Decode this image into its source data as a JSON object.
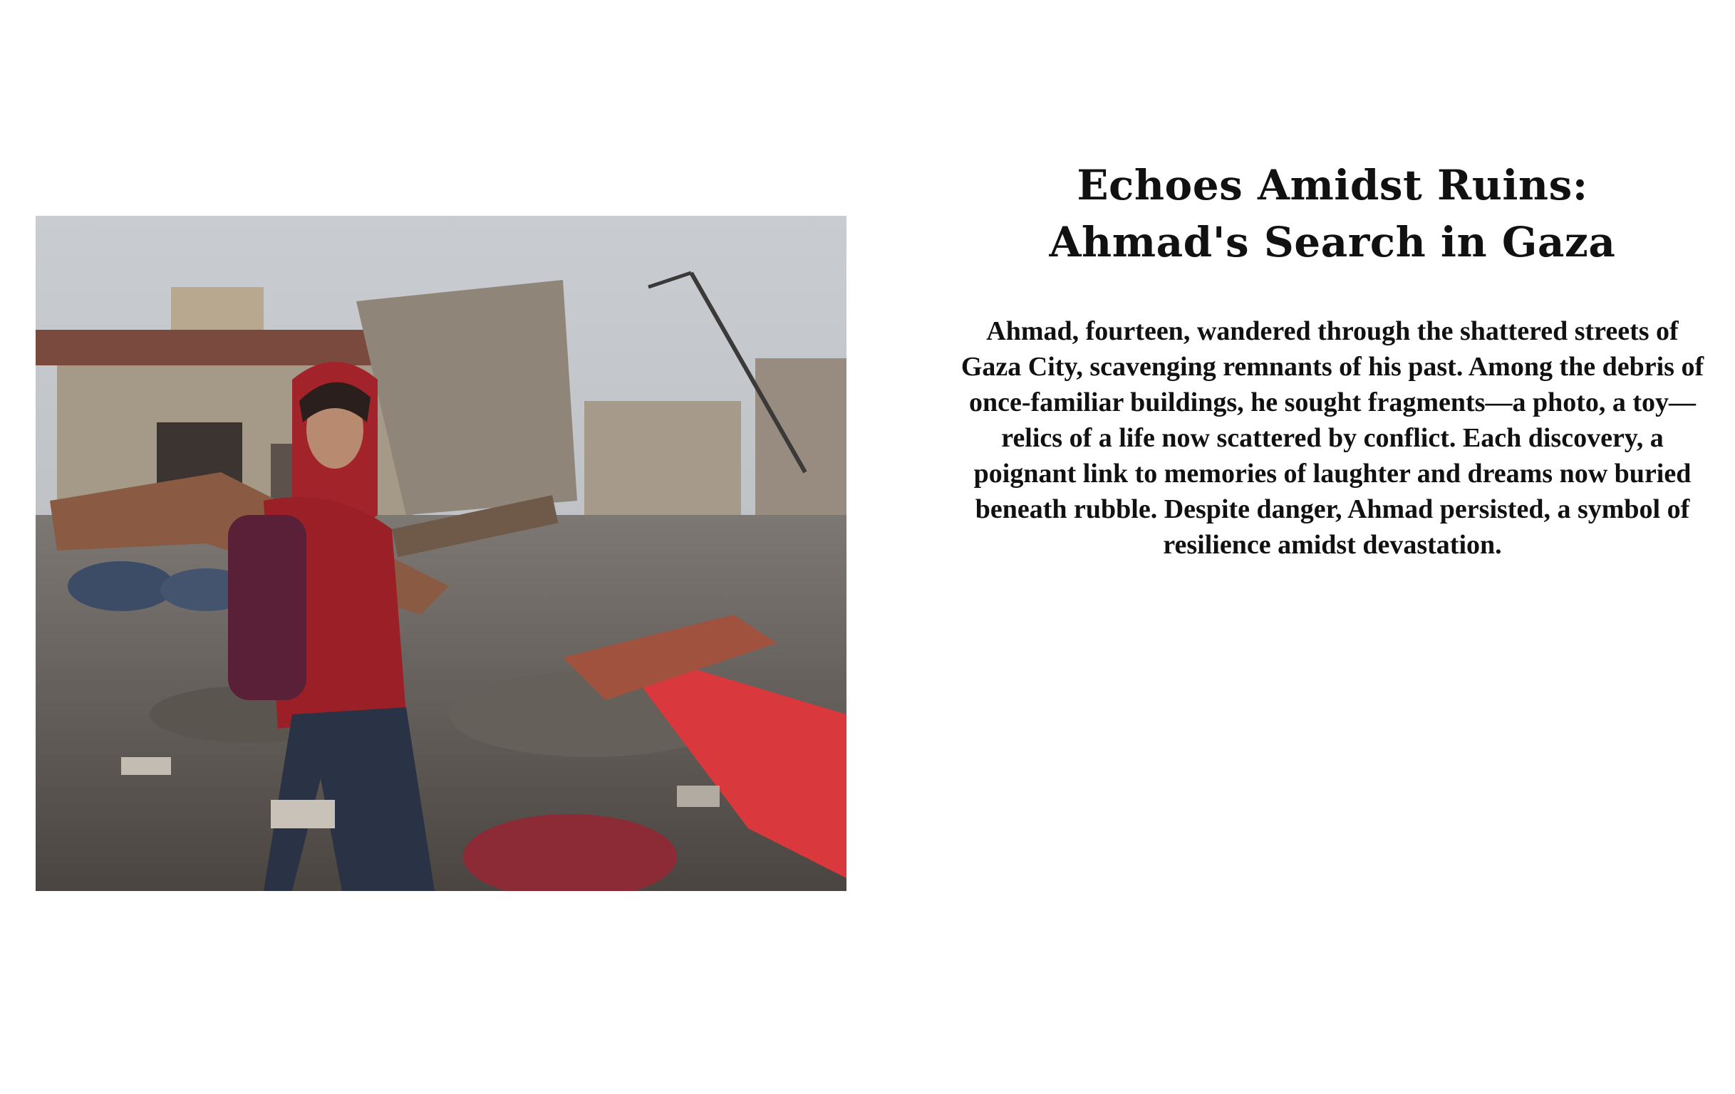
{
  "article": {
    "title_line1": "Echoes Amidst Ruins:",
    "title_line2": "Ahmad's Search in Gaza",
    "body": "Ahmad, fourteen, wandered through the shattered streets of Gaza City, scavenging remnants of his past. Among the debris of once-familiar buildings, he sought fragments—a photo, a toy—relics of a life now scattered by conflict. Each discovery, a poignant link to memories of laughter and dreams now buried beneath rubble. Despite danger, Ahmad persisted, a symbol of resilience amidst devastation."
  },
  "photo": {
    "subject": "boy-in-red-hoodie-carrying-wood-in-rubble"
  }
}
